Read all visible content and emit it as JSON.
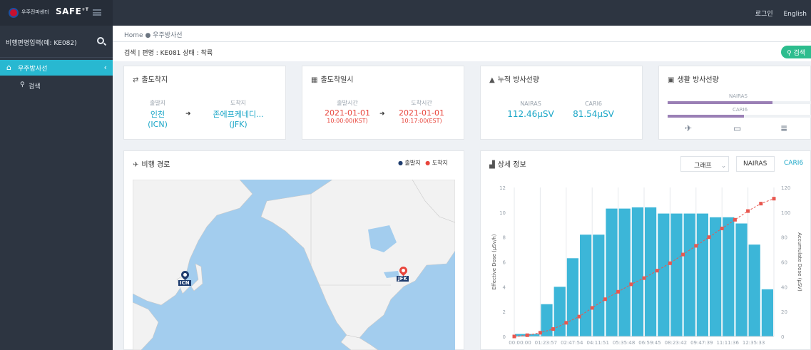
{
  "header": {
    "logo_text": "우주전파센터",
    "logo_brand": "SAFE",
    "logo_sup": "+T",
    "login": "로그인",
    "language": "English"
  },
  "sidebar": {
    "search_placeholder": "비행편명입력(예: KE082)",
    "menu": [
      {
        "label": "우주방사선",
        "active": true
      },
      {
        "label": "검색",
        "active": false
      }
    ]
  },
  "breadcrumb": {
    "home": "Home",
    "current": "우주방사선"
  },
  "search_info": {
    "text": "검색 | 편명 : KE081   상태 : 착륙",
    "button": "검색"
  },
  "cards": {
    "route": {
      "title": "출도착지",
      "dep_label": "출발지",
      "dep_city": "인천",
      "dep_code": "(ICN)",
      "arr_label": "도착지",
      "arr_city": "존에프케네디...",
      "arr_code": "(JFK)"
    },
    "time": {
      "title": "출도착일시",
      "dep_label": "출발시간",
      "dep_date": "2021-01-01",
      "dep_time": "10:00:00(KST)",
      "arr_label": "도착시간",
      "arr_date": "2021-01-01",
      "arr_time": "10:17:00(EST)"
    },
    "total": {
      "title": "누적 방사선량",
      "nairas_label": "NAIRAS",
      "nairas_value": "112.46μSV",
      "cari6_label": "CARI6",
      "cari6_value": "81.54μSV"
    },
    "life": {
      "title": "생활 방사선량",
      "nairas_label": "NAIRAS",
      "cari6_label": "CARI6",
      "nairas_fraction": 0.73,
      "cari6_fraction": 0.53
    },
    "flight_path": {
      "title": "비행 경로",
      "legend_dep": "출발지",
      "legend_arr": "도착지",
      "icn": "ICN",
      "jfk": "JFK"
    },
    "detail": {
      "title": "상세 정보",
      "view_select": "그래프",
      "tab_nairas": "NAIRAS",
      "tab_cari6": "CARI6"
    }
  },
  "colors": {
    "accent": "#28b8d1",
    "bar": "#3cb6d8",
    "line": "#e8574f",
    "departure": "#1e3c6e",
    "arrival": "#e8453c",
    "search_button": "#2dbd8e"
  },
  "chart_data": {
    "type": "bar",
    "ylabel": "Effective Dose (μSv/h)",
    "ylabel_right": "Accumulate Dose (μSV)",
    "ylim": [
      0,
      12
    ],
    "yticks": [
      0,
      2,
      4,
      6,
      8,
      10,
      12
    ],
    "ylim_right": [
      0,
      120
    ],
    "yticks_right": [
      0,
      20,
      40,
      60,
      80,
      100,
      120
    ],
    "xticks": [
      "00:00:00",
      "01:23:57",
      "02:47:54",
      "04:11:51",
      "05:35:48",
      "06:59:45",
      "08:23:42",
      "09:47:39",
      "11:11:36",
      "12:35:33"
    ],
    "series": [
      {
        "values": [
          0.2,
          0.2,
          2.6,
          4.0,
          6.3,
          8.2,
          8.2,
          10.3,
          10.3,
          10.4,
          10.4,
          9.9,
          9.9,
          9.9,
          9.9,
          9.6,
          9.6,
          9.1,
          7.4,
          3.8
        ]
      },
      {
        "values": [
          0,
          1,
          3,
          6,
          11,
          16,
          23,
          30,
          36,
          42,
          47,
          53,
          59,
          66,
          73,
          80,
          87,
          94,
          101,
          107,
          111
        ]
      }
    ]
  }
}
